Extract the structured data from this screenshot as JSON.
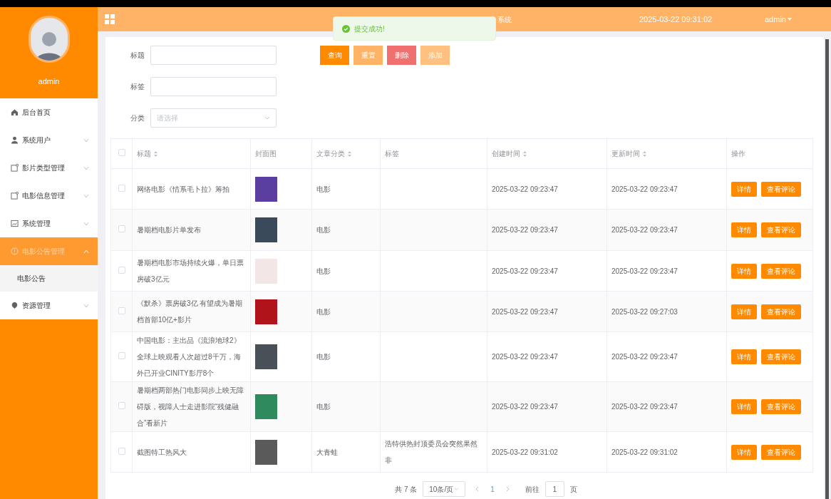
{
  "sidebar": {
    "username": "admin",
    "menu": [
      {
        "label": "后台首页",
        "has_children": false,
        "selected": false
      },
      {
        "label": "系统用户",
        "has_children": true,
        "expanded": false,
        "selected": false
      },
      {
        "label": "影片类型管理",
        "has_children": true,
        "expanded": false,
        "selected": false
      },
      {
        "label": "电影信息管理",
        "has_children": true,
        "expanded": false,
        "selected": false
      },
      {
        "label": "系统管理",
        "has_children": true,
        "expanded": false,
        "selected": false
      },
      {
        "label": "电影公告管理",
        "has_children": true,
        "expanded": true,
        "selected": true,
        "children": [
          {
            "label": "电影公告",
            "selected": false
          }
        ]
      },
      {
        "label": "资源管理",
        "has_children": true,
        "expanded": false,
        "selected": false
      }
    ]
  },
  "header": {
    "title": "系统",
    "datetime": "2025-03-22 09:31:02",
    "user": "admin"
  },
  "toast": {
    "message": "提交成功!"
  },
  "filters": [
    {
      "label": "标题",
      "kind": "input"
    },
    {
      "label": "标签",
      "kind": "input"
    },
    {
      "label": "分类",
      "kind": "select",
      "placeholder": "请选择"
    }
  ],
  "buttons": [
    {
      "label": "查询",
      "kind": "primary"
    },
    {
      "label": "重置",
      "kind": "warning"
    },
    {
      "label": "删除",
      "kind": "danger"
    },
    {
      "label": "添加",
      "kind": "light"
    }
  ],
  "table": {
    "all_checked": false,
    "columns": [
      {
        "label": "标题",
        "sortable": true
      },
      {
        "label": "封面图",
        "sortable": false
      },
      {
        "label": "文章分类",
        "sortable": true
      },
      {
        "label": "标签",
        "sortable": false
      },
      {
        "label": "创建时间",
        "sortable": true
      },
      {
        "label": "更新时间",
        "sortable": true
      },
      {
        "label": "操作",
        "sortable": false
      }
    ],
    "rows": [
      {
        "checked": false,
        "title": "网络电影《情系毛卜拉》筹拍",
        "color": "#5b3fa0",
        "category": "电影",
        "created": "2025-03-22 09:23:47",
        "updated": "2025-03-22 09:23:47",
        "actions": [
          "详情",
          "查看评论"
        ]
      },
      {
        "checked": false,
        "title": "暑期档电影片单发布",
        "color": "#3a4a5a",
        "category": "电影",
        "created": "2025-03-22 09:23:47",
        "updated": "2025-03-22 09:23:47",
        "actions": [
          "详情",
          "查看评论"
        ]
      },
      {
        "checked": false,
        "title": "暑期档电影市场持续火爆，单日票房破3亿元",
        "color": "#f3e6e6",
        "category": "电影",
        "created": "2025-03-22 09:23:47",
        "updated": "2025-03-22 09:23:47",
        "actions": [
          "详情",
          "查看评论"
        ]
      },
      {
        "checked": false,
        "title": "《默杀》票房破3亿 有望成为暑期档首部10亿+影片",
        "color": "#b0141a",
        "category": "电影",
        "created": "2025-03-22 09:23:47",
        "updated": "2025-03-22 09:27:03",
        "actions": [
          "详情",
          "查看评论"
        ]
      },
      {
        "checked": false,
        "title": "中国电影：主出品《流浪地球2》全球上映观看人次超过8千万，海外已开业CINITY影厅8个",
        "color": "#4a5058",
        "category": "电影",
        "created": "2025-03-22 09:23:47",
        "updated": "2025-03-22 09:23:47",
        "actions": [
          "详情",
          "查看评论"
        ]
      },
      {
        "checked": false,
        "title": "暑期档两部热门电影同步上映无障碍版，视障人士走进影院“残健融合”看新片",
        "color": "#2f8a5e",
        "category": "电影",
        "created": "2025-03-22 09:23:47",
        "updated": "2025-03-22 09:23:47",
        "actions": [
          "详情",
          "查看评论"
        ]
      },
      {
        "checked": false,
        "title": "截图特工热风大",
        "color": "#5a5a5a",
        "category": "大青蛙",
        "tag": "浩特供热封顶委员会突然果然非",
        "created": "2025-03-22 09:31:02",
        "updated": "2025-03-22 09:31:02",
        "actions": [
          "详情",
          "查看评论"
        ]
      }
    ]
  },
  "pagination": {
    "total": "共 7 条",
    "page_size": "10条/页",
    "pages": [
      {
        "label": "1",
        "selected": true
      }
    ],
    "goto_label": "前往",
    "goto_value": "1",
    "goto_suffix": "页"
  }
}
